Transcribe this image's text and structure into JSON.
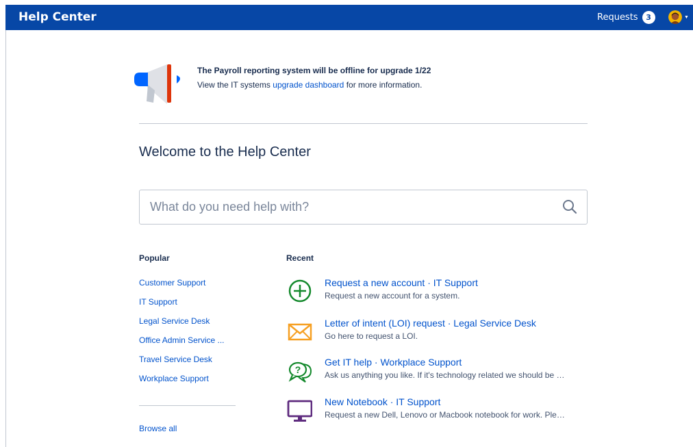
{
  "header": {
    "brand": "Help Center",
    "requests_label": "Requests",
    "requests_count": "3",
    "accent_color": "#0747a6"
  },
  "announcement": {
    "title": "The Payroll reporting system will be offline for upgrade 1/22",
    "body_prefix": "View the IT systems ",
    "link_text": "upgrade dashboard",
    "body_suffix": " for more information.",
    "icon": "megaphone-icon"
  },
  "welcome": "Welcome to the Help Center",
  "search": {
    "placeholder": "What do you need help with?",
    "value": "",
    "icon": "search-icon"
  },
  "popular": {
    "heading": "Popular",
    "items": [
      "Customer Support",
      "IT Support",
      "Legal Service Desk",
      "Office Admin Service ...",
      "Travel Service Desk",
      "Workplace Support"
    ],
    "browse_all": "Browse all"
  },
  "recent": {
    "heading": "Recent",
    "items": [
      {
        "title": "Request a new account · IT Support",
        "desc": "Request a new account for a system.",
        "icon": "plus-circle-icon",
        "color": "#14892c"
      },
      {
        "title": "Letter of intent (LOI) request · Legal Service Desk",
        "desc": "Go here to request a LOI.",
        "icon": "envelope-icon",
        "color": "#f6a023"
      },
      {
        "title": "Get IT help · Workplace Support",
        "desc": "Ask us anything you like. If it's technology related we should be …",
        "icon": "question-chat-icon",
        "color": "#14892c"
      },
      {
        "title": "New Notebook · IT Support",
        "desc": "Request a new Dell, Lenovo or Macbook notebook for work. Ple…",
        "icon": "monitor-icon",
        "color": "#5e2b7e"
      }
    ]
  }
}
